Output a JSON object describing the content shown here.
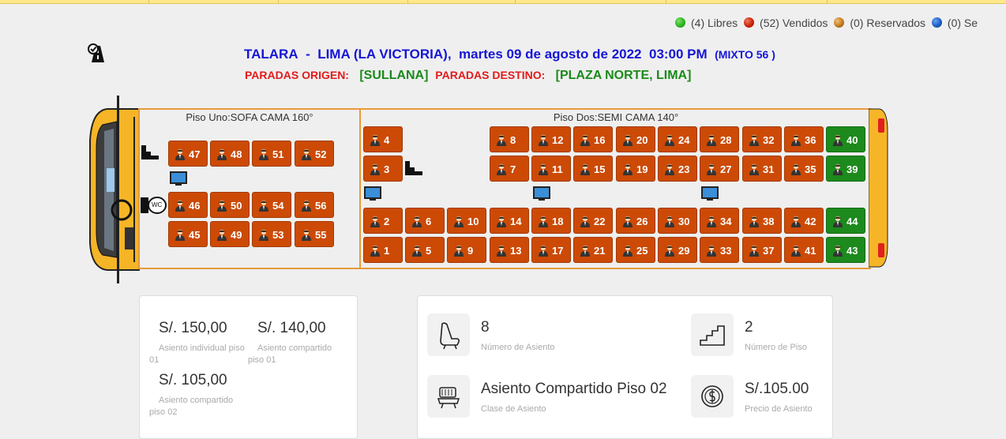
{
  "legend": [
    {
      "label": "(4) Libres",
      "color": "#2db51f"
    },
    {
      "label": "(52) Vendidos",
      "color": "#c8220a"
    },
    {
      "label": "(0) Reservados",
      "color": "#c47a1c"
    },
    {
      "label": "(0) Se",
      "color": "#1c5ec4"
    }
  ],
  "route": {
    "origin": "TALARA",
    "dash": "-",
    "destination": "LIMA (LA VICTORIA),",
    "date": "martes 09 de agosto de 2022",
    "time": "03:00 PM",
    "service": "(MIXTO 56 )"
  },
  "paradas": {
    "origin_label": "PARADAS ORIGEN:",
    "origin_value": "[SULLANA]",
    "dest_label": "PARADAS DESTINO:",
    "dest_value": "[PLAZA NORTE, LIMA]"
  },
  "bus": {
    "deck1_title": "Piso Uno:SOFA CAMA 160°",
    "deck2_title": "Piso Dos:SEMI CAMA 140°",
    "wc_label": "WC",
    "deck1_seats": [
      {
        "n": "47",
        "status": "sold"
      },
      {
        "n": "48",
        "status": "sold"
      },
      {
        "n": "51",
        "status": "sold"
      },
      {
        "n": "52",
        "status": "sold"
      },
      {
        "n": "46",
        "status": "sold"
      },
      {
        "n": "50",
        "status": "sold"
      },
      {
        "n": "54",
        "status": "sold"
      },
      {
        "n": "56",
        "status": "sold"
      },
      {
        "n": "45",
        "status": "sold"
      },
      {
        "n": "49",
        "status": "sold"
      },
      {
        "n": "53",
        "status": "sold"
      },
      {
        "n": "55",
        "status": "sold"
      }
    ],
    "deck2_seats": [
      {
        "n": "4",
        "status": "sold"
      },
      {
        "n": "8",
        "status": "sold"
      },
      {
        "n": "12",
        "status": "sold"
      },
      {
        "n": "16",
        "status": "sold"
      },
      {
        "n": "20",
        "status": "sold"
      },
      {
        "n": "24",
        "status": "sold"
      },
      {
        "n": "28",
        "status": "sold"
      },
      {
        "n": "32",
        "status": "sold"
      },
      {
        "n": "36",
        "status": "sold"
      },
      {
        "n": "40",
        "status": "free"
      },
      {
        "n": "3",
        "status": "sold"
      },
      {
        "n": "7",
        "status": "sold"
      },
      {
        "n": "11",
        "status": "sold"
      },
      {
        "n": "15",
        "status": "sold"
      },
      {
        "n": "19",
        "status": "sold"
      },
      {
        "n": "23",
        "status": "sold"
      },
      {
        "n": "27",
        "status": "sold"
      },
      {
        "n": "31",
        "status": "sold"
      },
      {
        "n": "35",
        "status": "sold"
      },
      {
        "n": "39",
        "status": "free"
      },
      {
        "n": "2",
        "status": "sold"
      },
      {
        "n": "6",
        "status": "sold"
      },
      {
        "n": "10",
        "status": "sold"
      },
      {
        "n": "14",
        "status": "sold"
      },
      {
        "n": "18",
        "status": "sold"
      },
      {
        "n": "22",
        "status": "sold"
      },
      {
        "n": "26",
        "status": "sold"
      },
      {
        "n": "30",
        "status": "sold"
      },
      {
        "n": "34",
        "status": "sold"
      },
      {
        "n": "38",
        "status": "sold"
      },
      {
        "n": "42",
        "status": "sold"
      },
      {
        "n": "44",
        "status": "free"
      },
      {
        "n": "1",
        "status": "sold"
      },
      {
        "n": "5",
        "status": "sold"
      },
      {
        "n": "9",
        "status": "sold"
      },
      {
        "n": "13",
        "status": "sold"
      },
      {
        "n": "17",
        "status": "sold"
      },
      {
        "n": "21",
        "status": "sold"
      },
      {
        "n": "25",
        "status": "sold"
      },
      {
        "n": "29",
        "status": "sold"
      },
      {
        "n": "33",
        "status": "sold"
      },
      {
        "n": "37",
        "status": "sold"
      },
      {
        "n": "41",
        "status": "sold"
      },
      {
        "n": "43",
        "status": "free"
      }
    ]
  },
  "prices": [
    {
      "value": "S/. 150,00",
      "label_a": "Asiento individual piso",
      "label_b": "01"
    },
    {
      "value": "S/. 140,00",
      "label_a": "Asiento compartido",
      "label_b": "piso 01"
    },
    {
      "value": "S/. 105,00",
      "label_a": "Asiento compartido",
      "label_b": "piso 02"
    }
  ],
  "info": {
    "seat_value": "8",
    "seat_label": "Número de Asiento",
    "floor_value": "2",
    "floor_label": "Número de Piso",
    "class_value": "Asiento Compartido Piso 02",
    "class_label": "Clase de Asiento",
    "price_value": "S/.105.00",
    "price_label": "Precio de Asiento"
  }
}
